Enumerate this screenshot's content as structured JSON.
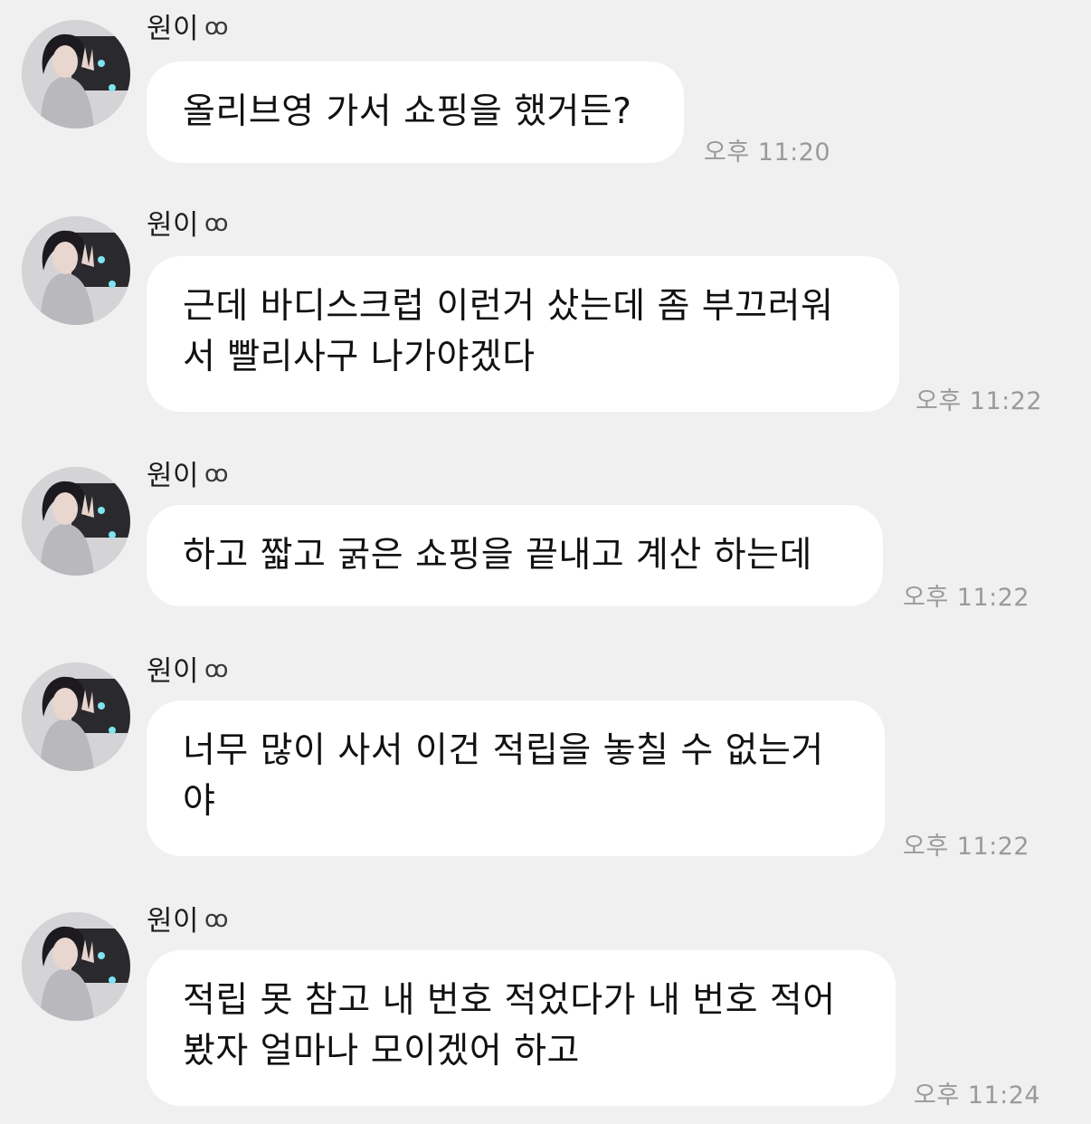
{
  "colors": {
    "background": "#f0f0f1",
    "bubble": "#ffffff",
    "text": "#111111",
    "timestamp": "#9a9a9d"
  },
  "messages": [
    {
      "sender": "원이",
      "sender_icon": "ꝏ",
      "text": "올리브영 가서 쇼핑을 했거든?",
      "time": "오후 11:20"
    },
    {
      "sender": "원이",
      "sender_icon": "ꝏ",
      "text": "근데 바디스크럽 이런거 샀는데 좀 부끄러워\n서 빨리사구 나가야겠다",
      "time": "오후 11:22"
    },
    {
      "sender": "원이",
      "sender_icon": "ꝏ",
      "text": "하고 짧고 굵은 쇼핑을 끝내고 계산 하는데",
      "time": "오후 11:22"
    },
    {
      "sender": "원이",
      "sender_icon": "ꝏ",
      "text": "너무 많이 사서 이건 적립을 놓칠 수 없는거\n야",
      "time": "오후 11:22"
    },
    {
      "sender": "원이",
      "sender_icon": "ꝏ",
      "text": "적립 못 참고 내 번호 적었다가 내 번호 적어\n봤자 얼마나 모이겠어 하고",
      "time": "오후 11:24"
    }
  ]
}
